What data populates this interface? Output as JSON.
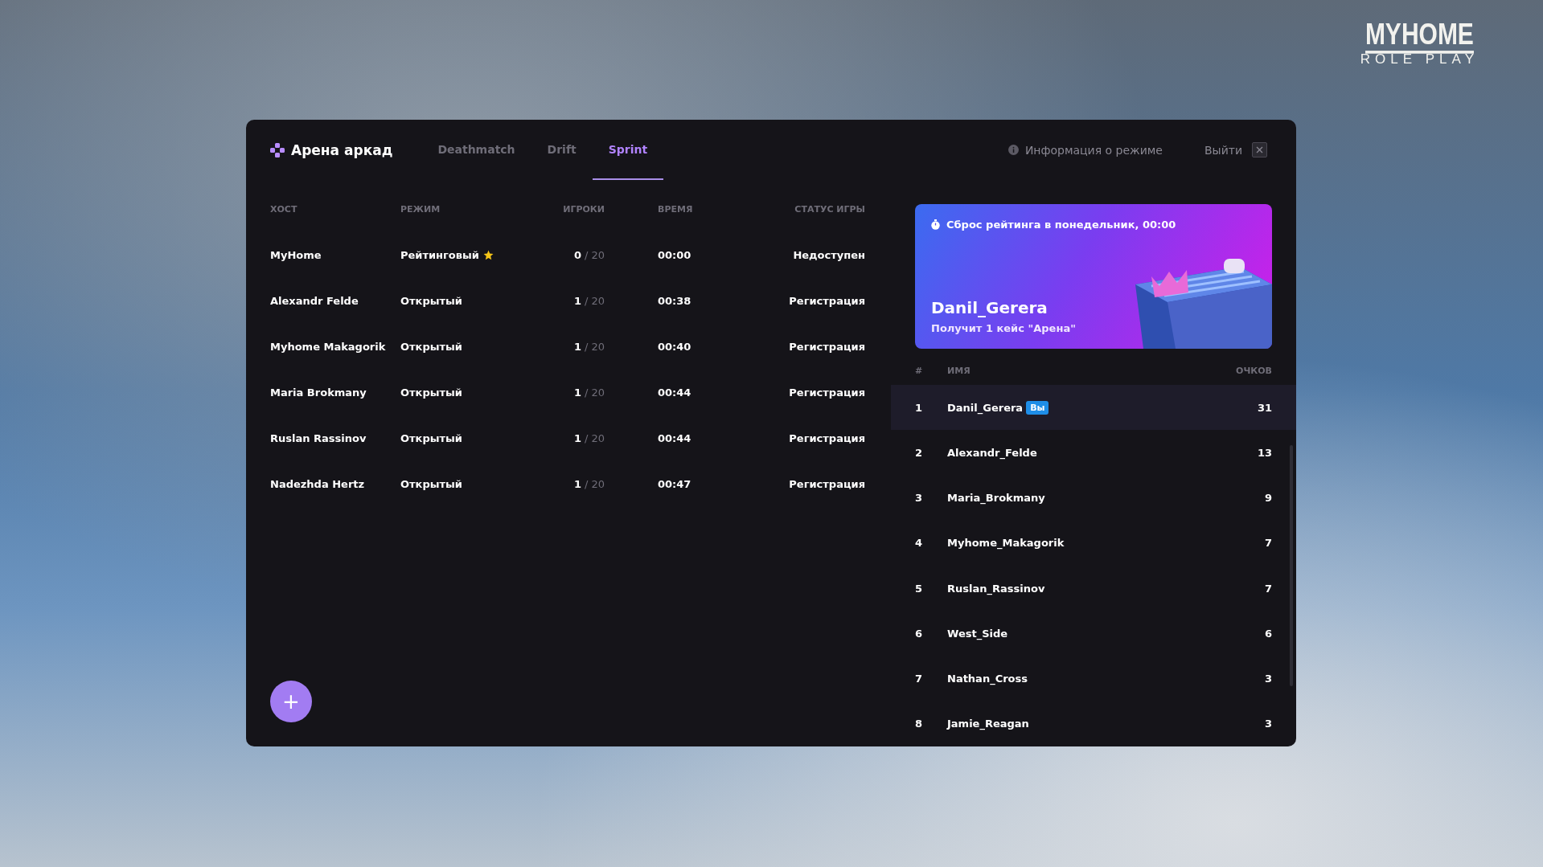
{
  "logo": {
    "title": "MYHOME",
    "subtitle": "ROLE PLAY"
  },
  "window": {
    "title": "Арена аркад",
    "tabs": [
      {
        "label": "Deathmatch",
        "selected": false
      },
      {
        "label": "Drift",
        "selected": false
      },
      {
        "label": "Sprint",
        "selected": true
      }
    ],
    "info_link": "Информация о режиме",
    "exit_button": "Выйти"
  },
  "lobbies": {
    "columns": [
      "ХОСТ",
      "РЕЖИМ",
      "ИГРОКИ",
      "ВРЕМЯ",
      "СТАТУС ИГРЫ"
    ],
    "rows": [
      {
        "host": "MyHome",
        "mode": "Рейтинговый",
        "ranked": true,
        "players": "0",
        "max_players": "/ 20",
        "time": "00:00",
        "status": "Недоступен"
      },
      {
        "host": "Alexandr Felde",
        "mode": "Открытый",
        "ranked": false,
        "players": "1",
        "max_players": "/ 20",
        "time": "00:38",
        "status": "Регистрация"
      },
      {
        "host": "Myhome Makagorik",
        "mode": "Открытый",
        "ranked": false,
        "players": "1",
        "max_players": "/ 20",
        "time": "00:40",
        "status": "Регистрация"
      },
      {
        "host": "Maria Brokmany",
        "mode": "Открытый",
        "ranked": false,
        "players": "1",
        "max_players": "/ 20",
        "time": "00:44",
        "status": "Регистрация"
      },
      {
        "host": "Ruslan Rassinov",
        "mode": "Открытый",
        "ranked": false,
        "players": "1",
        "max_players": "/ 20",
        "time": "00:44",
        "status": "Регистрация"
      },
      {
        "host": "Nadezhda Hertz",
        "mode": "Открытый",
        "ranked": false,
        "players": "1",
        "max_players": "/ 20",
        "time": "00:47",
        "status": "Регистрация"
      }
    ],
    "create_button": "+"
  },
  "reward_banner": {
    "notice": "Сброс рейтинга в понедельник, 00:00",
    "leader": "Danil_Gerera",
    "reward": "Получит 1 кейс \"Арена\""
  },
  "leaderboard": {
    "columns": [
      "#",
      "ИМЯ",
      "ОЧКОВ"
    ],
    "rows": [
      {
        "rank": "1",
        "name": "Danil_Gerera",
        "badge": "Вы",
        "score": "31",
        "selected": true
      },
      {
        "rank": "2",
        "name": "Alexandr_Felde",
        "score": "13",
        "selected": false
      },
      {
        "rank": "3",
        "name": "Maria_Brokmany",
        "score": "9",
        "selected": false
      },
      {
        "rank": "4",
        "name": "Myhome_Makagorik",
        "score": "7",
        "selected": false
      },
      {
        "rank": "5",
        "name": "Ruslan_Rassinov",
        "score": "7",
        "selected": false
      },
      {
        "rank": "6",
        "name": "West_Side",
        "score": "6",
        "selected": false
      },
      {
        "rank": "7",
        "name": "Nathan_Cross",
        "score": "3",
        "selected": false
      },
      {
        "rank": "8",
        "name": "Jamie_Reagan",
        "score": "3",
        "selected": false
      }
    ]
  }
}
